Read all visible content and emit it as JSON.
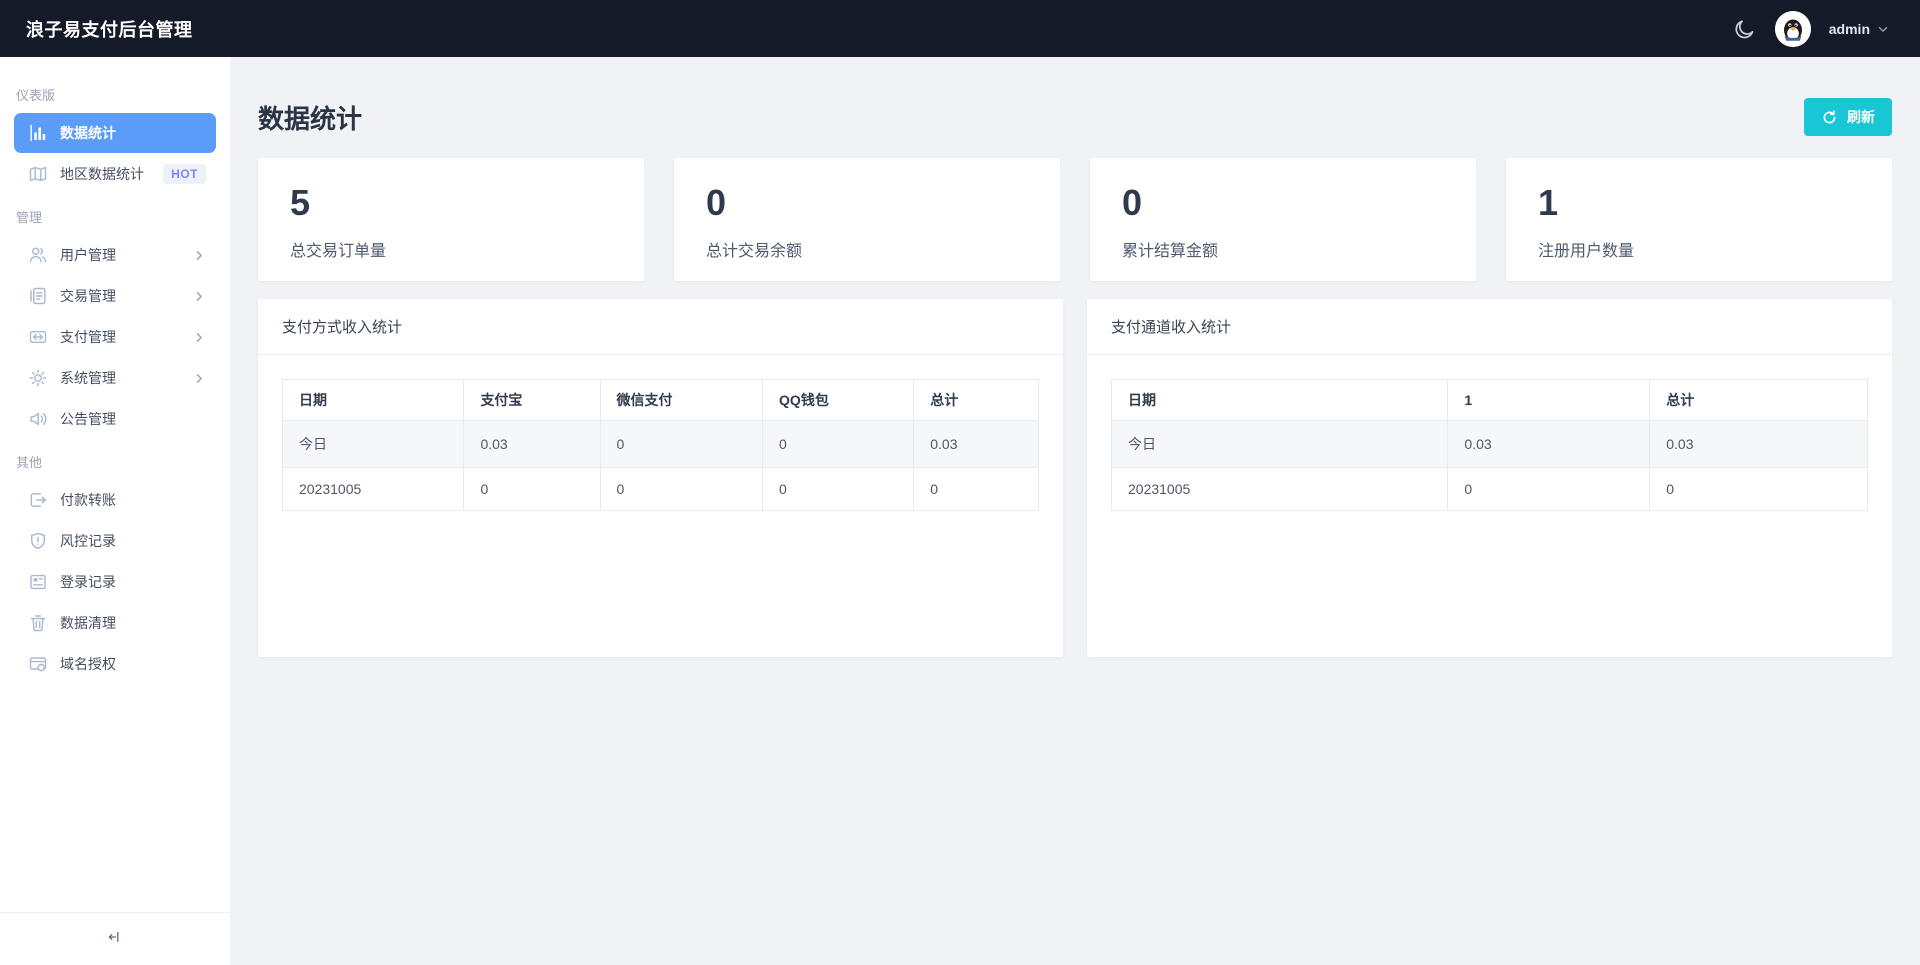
{
  "header": {
    "title": "浪子易支付后台管理",
    "username": "admin",
    "theme_icon": "moon-icon",
    "avatar_icon": "qq-penguin-avatar",
    "bg_color": "#141a27"
  },
  "sidebar": {
    "sections": [
      {
        "label": "仪表版",
        "items": [
          {
            "label": "数据统计",
            "icon": "bar-chart-icon",
            "active": true
          },
          {
            "label": "地区数据统计",
            "icon": "map-icon",
            "badge": "HOT"
          }
        ]
      },
      {
        "label": "管理",
        "items": [
          {
            "label": "用户管理",
            "icon": "users-icon",
            "expandable": true
          },
          {
            "label": "交易管理",
            "icon": "document-icon",
            "expandable": true
          },
          {
            "label": "支付管理",
            "icon": "transfer-icon",
            "expandable": true
          },
          {
            "label": "系统管理",
            "icon": "gear-icon",
            "expandable": true
          },
          {
            "label": "公告管理",
            "icon": "announcement-icon"
          }
        ]
      },
      {
        "label": "其他",
        "items": [
          {
            "label": "付款转账",
            "icon": "payout-icon"
          },
          {
            "label": "风控记录",
            "icon": "shield-alert-icon"
          },
          {
            "label": "登录记录",
            "icon": "login-log-icon"
          },
          {
            "label": "数据清理",
            "icon": "trash-icon"
          },
          {
            "label": "域名授权",
            "icon": "domain-icon"
          }
        ]
      }
    ],
    "collapse_icon": "collapse-left-icon",
    "active_color": "#5b9cf9",
    "hot_badge_color": "#7d88f8"
  },
  "main": {
    "page_title": "数据统计",
    "refresh_label": "刷新",
    "refresh_color": "#19c6d5",
    "stat_cards": [
      {
        "value": "5",
        "label": "总交易订单量"
      },
      {
        "value": "0",
        "label": "总计交易余额"
      },
      {
        "value": "0",
        "label": "累计结算金额"
      },
      {
        "value": "1",
        "label": "注册用户数量"
      }
    ],
    "tables": [
      {
        "title": "支付方式收入统计",
        "columns": [
          "日期",
          "支付宝",
          "微信支付",
          "QQ钱包",
          "总计"
        ],
        "rows": [
          [
            "今日",
            "0.03",
            "0",
            "0",
            "0.03"
          ],
          [
            "20231005",
            "0",
            "0",
            "0",
            "0"
          ]
        ]
      },
      {
        "title": "支付通道收入统计",
        "columns": [
          "日期",
          "1",
          "总计"
        ],
        "rows": [
          [
            "今日",
            "0.03",
            "0.03"
          ],
          [
            "20231005",
            "0",
            "0"
          ]
        ]
      }
    ]
  }
}
